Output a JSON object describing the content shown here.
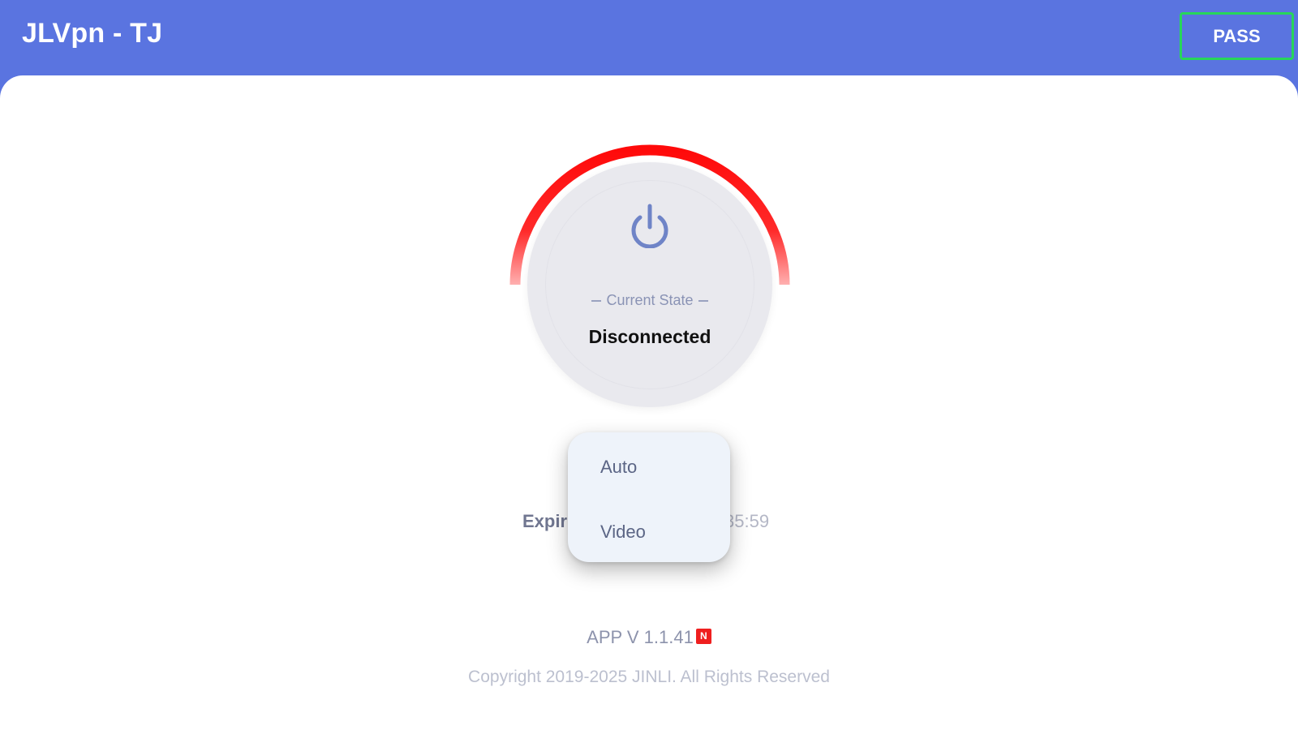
{
  "header": {
    "title": "JLVpn - TJ",
    "pass_label": "PASS",
    "bar_color": "#5a74e0",
    "pass_border_color": "#27d65a"
  },
  "status": {
    "label": "Current State",
    "value": "Disconnected",
    "ring_color": "#ff0a0a",
    "icon": "power-icon"
  },
  "expire": {
    "left_text": "Expir",
    "right_text": "35:59"
  },
  "menu": {
    "items": [
      {
        "label": "Auto"
      },
      {
        "label": "Video"
      }
    ]
  },
  "footer": {
    "version": "APP V 1.1.41",
    "badge": "N",
    "badge_color": "#ef1f1f",
    "copyright": "Copyright 2019-2025 JINLI. All Rights Reserved"
  }
}
